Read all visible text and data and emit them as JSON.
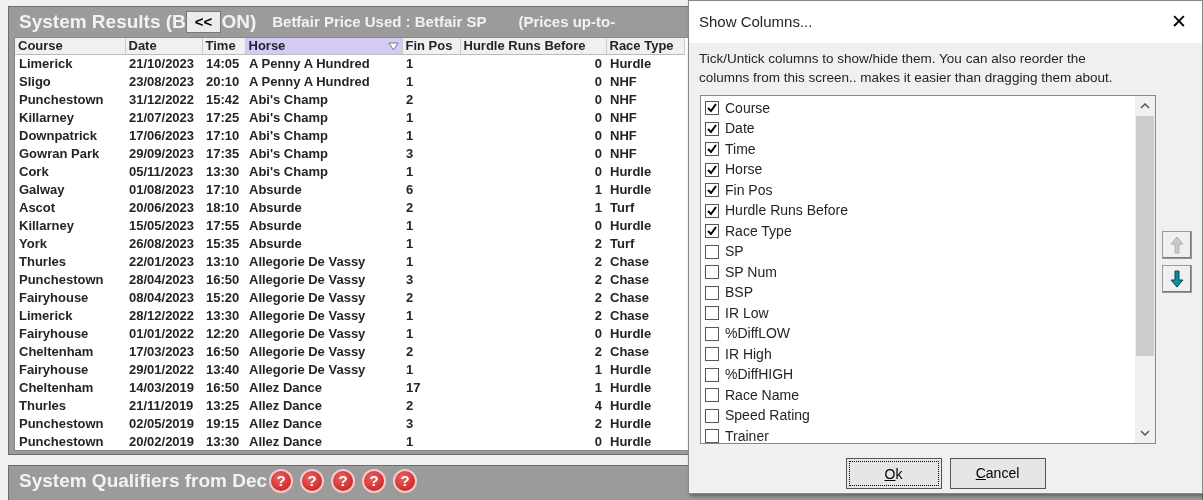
{
  "results_panel": {
    "title_start": "System Results (B",
    "collapse_button": "<<",
    "title_end": "ON)",
    "price_info": "Betfair Price Used : Betfair SP",
    "prices_note": "(Prices up-to-"
  },
  "table": {
    "columns": [
      {
        "label": "Course",
        "selected": false
      },
      {
        "label": "Date",
        "selected": false
      },
      {
        "label": "Time",
        "selected": false
      },
      {
        "label": "Horse",
        "selected": true
      },
      {
        "label": "Fin Pos",
        "selected": false
      },
      {
        "label": "Hurdle Runs Before",
        "selected": false
      },
      {
        "label": "Race Type",
        "selected": false
      }
    ],
    "rows": [
      [
        "Limerick",
        "21/10/2023",
        "14:05",
        "A Penny A Hundred",
        "1",
        "0",
        "Hurdle"
      ],
      [
        "Sligo",
        "23/08/2023",
        "20:10",
        "A Penny A Hundred",
        "1",
        "0",
        "NHF"
      ],
      [
        "Punchestown",
        "31/12/2022",
        "15:42",
        "Abi's Champ",
        "2",
        "0",
        "NHF"
      ],
      [
        "Killarney",
        "21/07/2023",
        "17:25",
        "Abi's Champ",
        "1",
        "0",
        "NHF"
      ],
      [
        "Downpatrick",
        "17/06/2023",
        "17:10",
        "Abi's Champ",
        "1",
        "0",
        "NHF"
      ],
      [
        "Gowran Park",
        "29/09/2023",
        "17:35",
        "Abi's Champ",
        "3",
        "0",
        "NHF"
      ],
      [
        "Cork",
        "05/11/2023",
        "13:30",
        "Abi's Champ",
        "1",
        "0",
        "Hurdle"
      ],
      [
        "Galway",
        "01/08/2023",
        "17:10",
        "Absurde",
        "6",
        "1",
        "Hurdle"
      ],
      [
        "Ascot",
        "20/06/2023",
        "18:10",
        "Absurde",
        "2",
        "1",
        "Turf"
      ],
      [
        "Killarney",
        "15/05/2023",
        "17:55",
        "Absurde",
        "1",
        "0",
        "Hurdle"
      ],
      [
        "York",
        "26/08/2023",
        "15:35",
        "Absurde",
        "1",
        "2",
        "Turf"
      ],
      [
        "Thurles",
        "22/01/2023",
        "13:10",
        "Allegorie De Vassy",
        "1",
        "2",
        "Chase"
      ],
      [
        "Punchestown",
        "28/04/2023",
        "16:50",
        "Allegorie De Vassy",
        "3",
        "2",
        "Chase"
      ],
      [
        "Fairyhouse",
        "08/04/2023",
        "15:20",
        "Allegorie De Vassy",
        "2",
        "2",
        "Chase"
      ],
      [
        "Limerick",
        "28/12/2022",
        "13:30",
        "Allegorie De Vassy",
        "1",
        "2",
        "Chase"
      ],
      [
        "Fairyhouse",
        "01/01/2022",
        "12:20",
        "Allegorie De Vassy",
        "1",
        "0",
        "Hurdle"
      ],
      [
        "Cheltenham",
        "17/03/2023",
        "16:50",
        "Allegorie De Vassy",
        "2",
        "2",
        "Chase"
      ],
      [
        "Fairyhouse",
        "29/01/2022",
        "13:40",
        "Allegorie De Vassy",
        "1",
        "1",
        "Hurdle"
      ],
      [
        "Cheltenham",
        "14/03/2019",
        "16:50",
        "Allez Dance",
        "17",
        "1",
        "Hurdle"
      ],
      [
        "Thurles",
        "21/11/2019",
        "13:25",
        "Allez Dance",
        "2",
        "4",
        "Hurdle"
      ],
      [
        "Punchestown",
        "02/05/2019",
        "19:15",
        "Allez Dance",
        "3",
        "2",
        "Hurdle"
      ],
      [
        "Punchestown",
        "20/02/2019",
        "13:30",
        "Allez Dance",
        "1",
        "0",
        "Hurdle"
      ]
    ]
  },
  "qualifiers_panel": {
    "title": "System Qualifiers from Dec",
    "help_icons": [
      "?",
      "?",
      "?",
      "?",
      "?"
    ]
  },
  "dialog": {
    "title": "Show Columns...",
    "close": "✕",
    "description": "Tick/Untick columns to show/hide them. You can also reorder the columns from this screen.. makes it easier than dragging them about.",
    "items": [
      {
        "label": "Course",
        "checked": true
      },
      {
        "label": "Date",
        "checked": true
      },
      {
        "label": "Time",
        "checked": true
      },
      {
        "label": "Horse",
        "checked": true
      },
      {
        "label": "Fin Pos",
        "checked": true
      },
      {
        "label": "Hurdle Runs Before",
        "checked": true
      },
      {
        "label": "Race Type",
        "checked": true
      },
      {
        "label": "SP",
        "checked": false
      },
      {
        "label": "SP Num",
        "checked": false
      },
      {
        "label": "BSP",
        "checked": false
      },
      {
        "label": "IR Low",
        "checked": false
      },
      {
        "label": "%DiffLOW",
        "checked": false
      },
      {
        "label": "IR High",
        "checked": false
      },
      {
        "label": "%DiffHIGH",
        "checked": false
      },
      {
        "label": "Race Name",
        "checked": false
      },
      {
        "label": "Speed Rating",
        "checked": false
      },
      {
        "label": "Trainer",
        "checked": false
      }
    ],
    "move_buttons": [
      {
        "kind": "up",
        "disabled": true
      },
      {
        "kind": "down",
        "disabled": false
      }
    ],
    "buttons": [
      {
        "label": "Ok",
        "focused": true
      },
      {
        "label": "Cancel",
        "focused": false
      }
    ]
  }
}
